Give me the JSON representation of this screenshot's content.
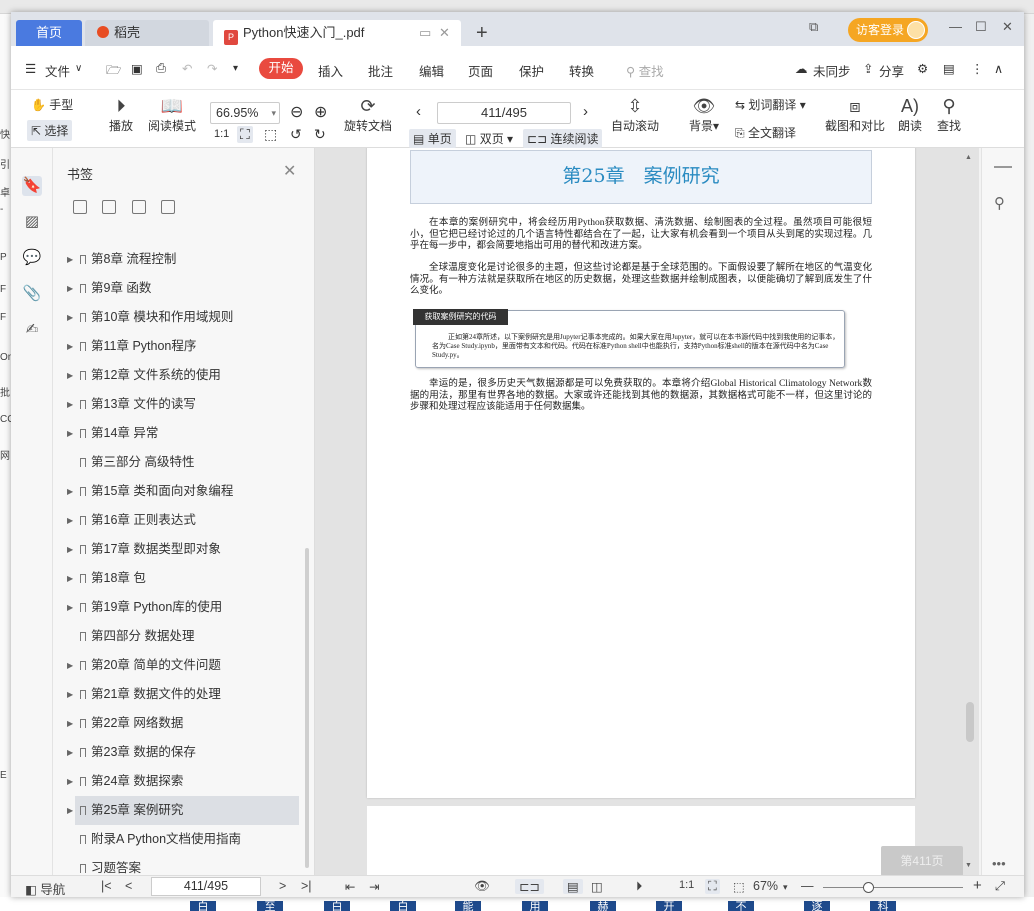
{
  "background": {
    "left_fragments": [
      "快",
      "引",
      "卓",
      "-",
      "P",
      "F",
      "F",
      "On",
      "批",
      "CC",
      "网",
      "E"
    ],
    "bottom_keys": [
      "白",
      "至",
      "白",
      "白",
      "能",
      "用",
      "赫",
      "开",
      "不",
      "逐",
      "科"
    ]
  },
  "tabs": {
    "home": "首页",
    "daoke": "稻壳",
    "doc": "Python快速入门_.pdf",
    "guest_login": "访客登录"
  },
  "menu": {
    "file": "文件",
    "start": "开始",
    "insert": "插入",
    "annotate": "批注",
    "edit": "编辑",
    "page": "页面",
    "protect": "保护",
    "convert": "转换",
    "search": "查找",
    "sync": "未同步",
    "share": "分享"
  },
  "toolbar": {
    "hand": "手型",
    "select": "选择",
    "play": "播放",
    "read_mode": "阅读模式",
    "zoom": "66.95%",
    "rotate": "旋转文档",
    "page_indicator": "411/495",
    "single": "单页",
    "double": "双页",
    "continuous": "连续阅读",
    "auto_scroll": "自动滚动",
    "background": "背景",
    "word_translate": "划词翻译",
    "full_translate": "全文翻译",
    "screenshot": "截图和对比",
    "read_aloud": "朗读",
    "find": "查找"
  },
  "bookmarks": {
    "title": "书签",
    "items": [
      {
        "label": "第8章 流程控制",
        "caret": true
      },
      {
        "label": "第9章 函数",
        "caret": true
      },
      {
        "label": "第10章 模块和作用域规则",
        "caret": true
      },
      {
        "label": "第11章 Python程序",
        "caret": true
      },
      {
        "label": "第12章 文件系统的使用",
        "caret": true
      },
      {
        "label": "第13章 文件的读写",
        "caret": true
      },
      {
        "label": "第14章 异常",
        "caret": true
      },
      {
        "label": "第三部分 高级特性",
        "caret": false
      },
      {
        "label": "第15章 类和面向对象编程",
        "caret": true
      },
      {
        "label": "第16章 正则表达式",
        "caret": true
      },
      {
        "label": "第17章 数据类型即对象",
        "caret": true
      },
      {
        "label": "第18章 包",
        "caret": true
      },
      {
        "label": "第19章 Python库的使用",
        "caret": true
      },
      {
        "label": "第四部分 数据处理",
        "caret": false
      },
      {
        "label": "第20章 简单的文件问题",
        "caret": true
      },
      {
        "label": "第21章 数据文件的处理",
        "caret": true
      },
      {
        "label": "第22章 网络数据",
        "caret": true
      },
      {
        "label": "第23章 数据的保存",
        "caret": true
      },
      {
        "label": "第24章 数据探索",
        "caret": true
      },
      {
        "label": "第25章 案例研究",
        "caret": true,
        "selected": true
      },
      {
        "label": "附录A Python文档使用指南",
        "caret": false
      },
      {
        "label": "习题答案",
        "caret": false
      }
    ]
  },
  "document": {
    "chapter_title": "第25章　案例研究",
    "para1": "在本章的案例研究中，将会经历用Python获取数据、清洗数据、绘制图表的全过程。虽然项目可能很短小，但它把已经讨论过的几个语言特性都结合在了一起，让大家有机会看到一个项目从头到尾的实现过程。几乎在每一步中，都会简要地指出可用的替代和改进方案。",
    "para2": "全球温度变化是讨论很多的主题，但这些讨论都是基于全球范围的。下面假设要了解所在地区的气温变化情况。有一种方法就是获取所在地区的历史数据，处理这些数据并绘制成图表，以便能确切了解到底发生了什么变化。",
    "code_box_title": "获取案例研究的代码",
    "code_box_text": "正如第24章所述，以下案例研究是用Jupyter记事本完成的。如果大家在用Jupyter，就可以在本书源代码中找到我使用的记事本，名为Case Study.ipynb，里面带有文本和代码。代码在标准Python shell中也能执行，支持Python标准shell的版本在源代码中名为Case Study.py。",
    "para3": "幸运的是，很多历史天气数据源都是可以免费获取的。本章将介绍Global Historical Climatology Network数据的用法，那里有世界各地的数据。大家或许还能找到其他的数据源，其数据格式可能不一样，但这里讨论的步骤和处理过程应该能适用于任何数据集。",
    "next_page_button": "第411页"
  },
  "statusbar": {
    "nav": "导航",
    "page_indicator": "411/495",
    "zoom": "67%"
  }
}
